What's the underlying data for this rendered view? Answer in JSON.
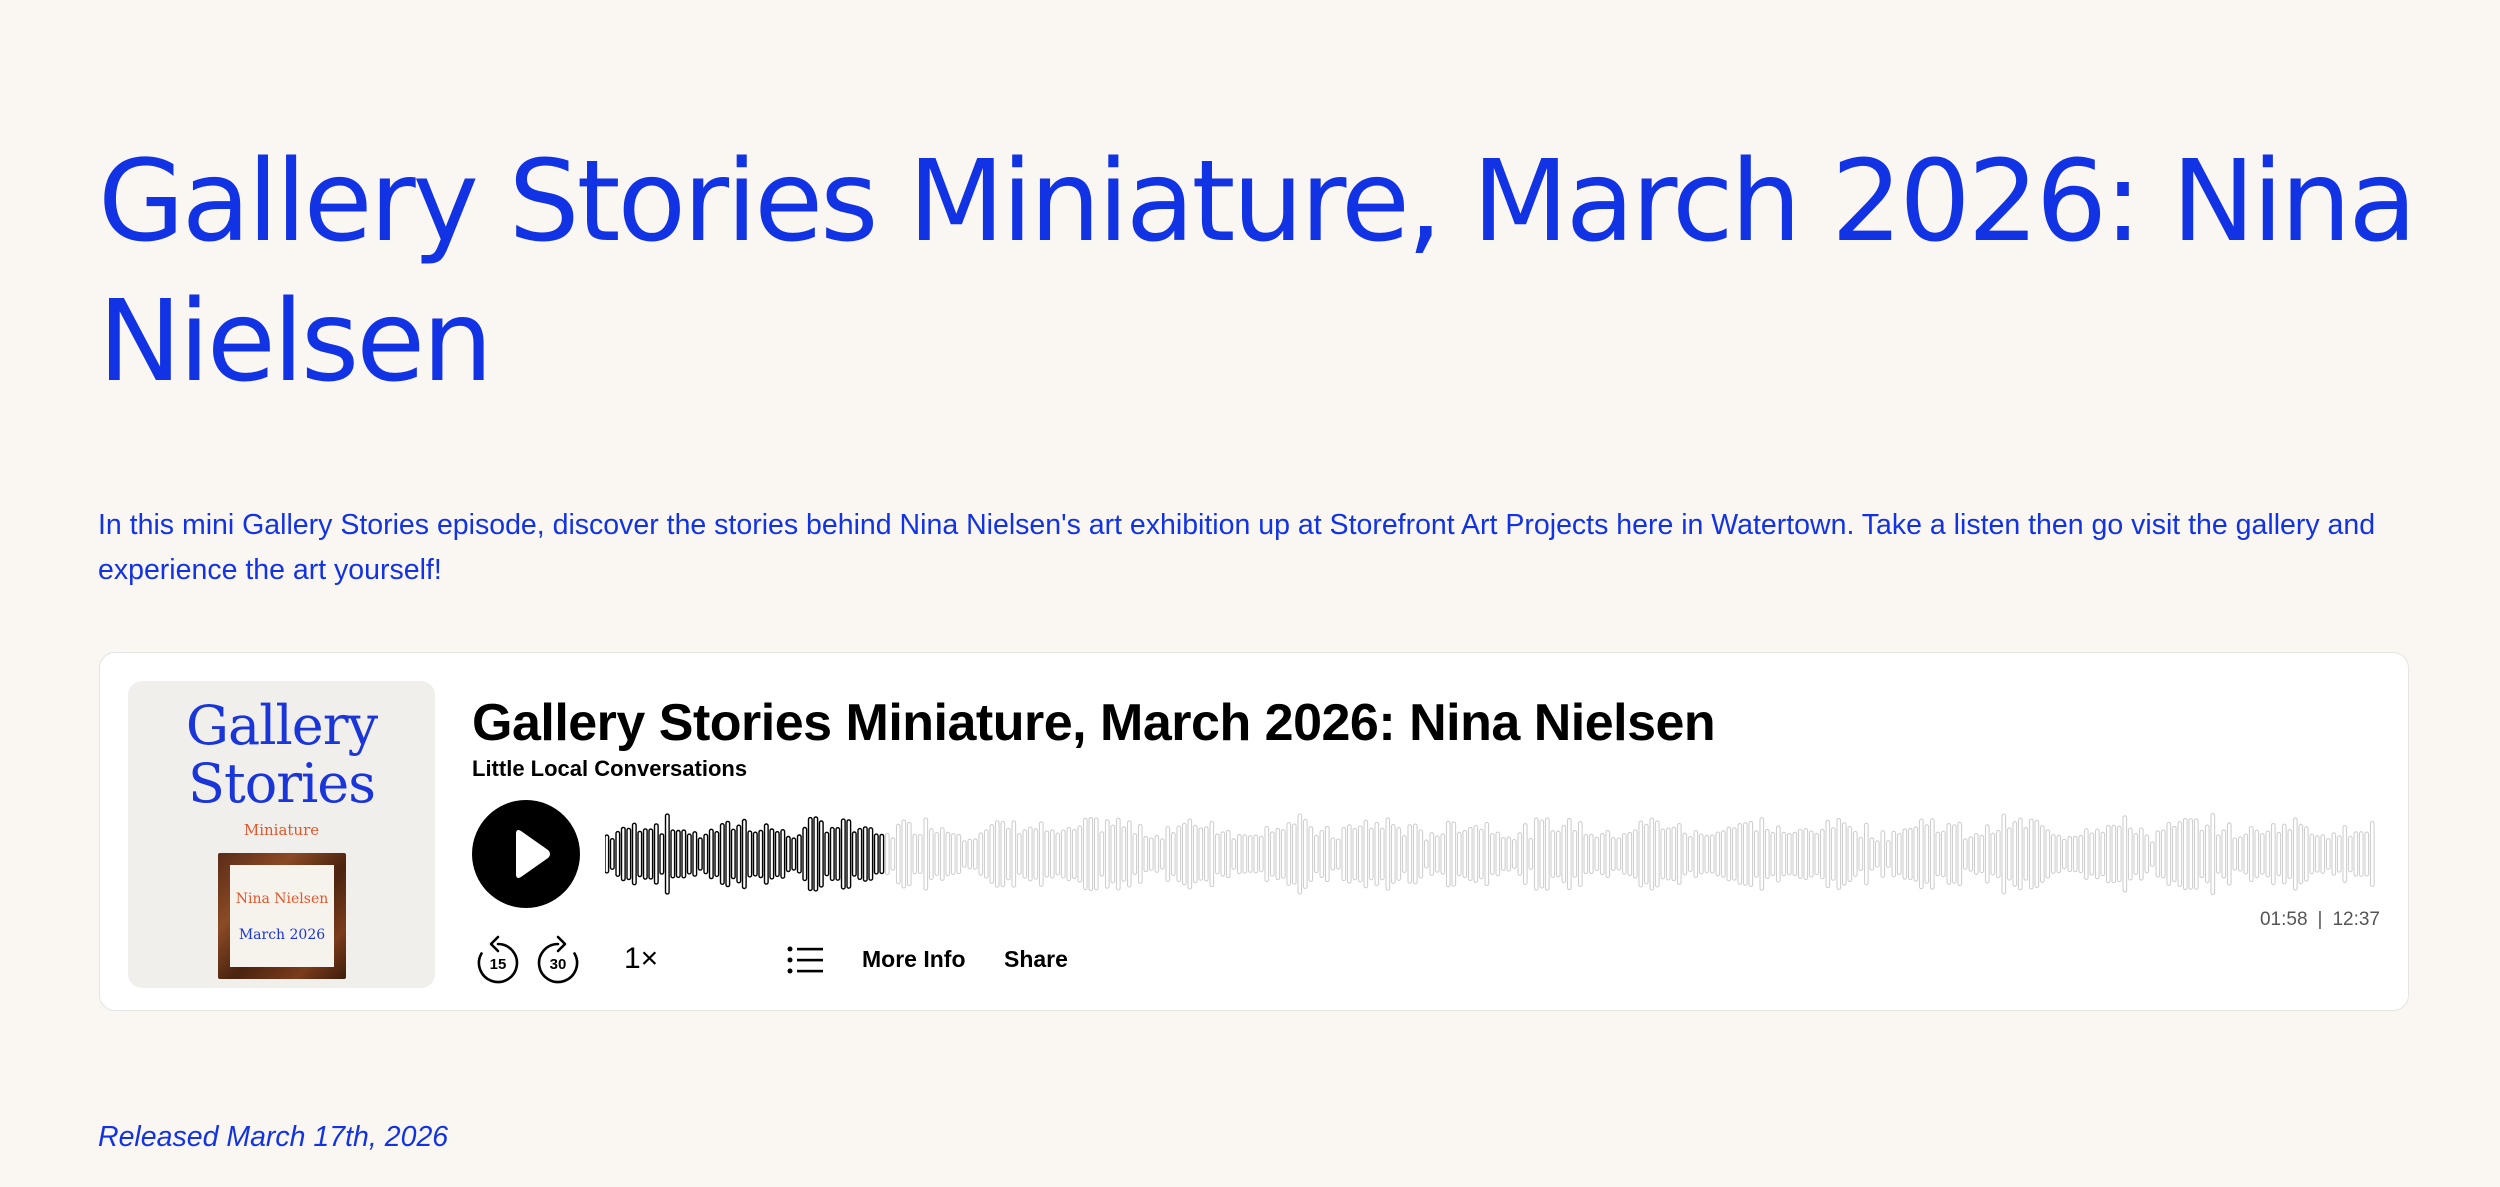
{
  "page": {
    "title": "Gallery Stories Miniature, March 2026: Nina Nielsen",
    "description": "In this mini Gallery Stories episode, discover the stories behind Nina Nielsen's art exhibition up at Storefront Art Projects here in Watertown. Take a listen then go visit the gallery and experience the art yourself!",
    "released": "Released March 17th, 2026"
  },
  "player": {
    "cover": {
      "title_line1": "Gallery",
      "title_line2": "Stories",
      "subtitle": "Miniature",
      "name": "Nina Nielsen",
      "date": "March 2026"
    },
    "episode_title": "Gallery Stories Miniature, March 2026: Nina Nielsen",
    "show_name": "Little Local Conversations",
    "elapsed": "01:58",
    "duration": "12:37",
    "progress_fraction": 0.156,
    "skip_back_seconds": "15",
    "skip_forward_seconds": "30",
    "speed": "1×",
    "more_info_label": "More Info",
    "share_label": "Share",
    "icons": {
      "play": "play-icon",
      "skip_back": "rewind-15-icon",
      "skip_forward": "forward-30-icon",
      "chapters": "list-icon"
    }
  },
  "colors": {
    "accent": "#1233e4",
    "background": "#faf6f2",
    "waveform_played": "#000000",
    "waveform_unplayed": "#cfcfcf"
  }
}
